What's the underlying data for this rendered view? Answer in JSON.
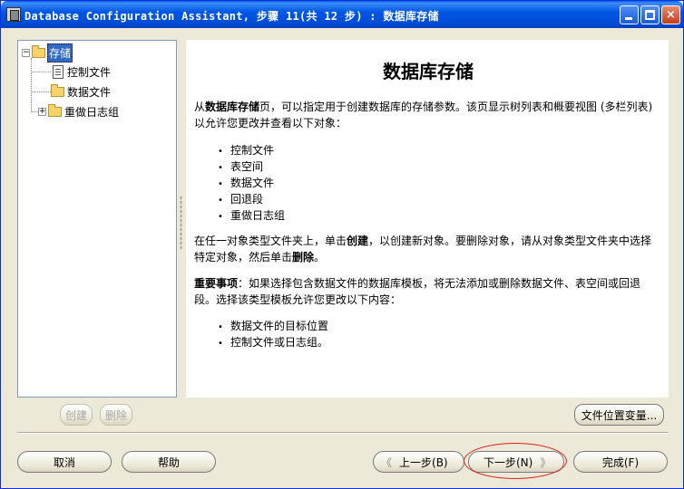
{
  "window": {
    "title": "Database Configuration Assistant, 步骤 11(共 12 步) : 数据库存储",
    "minimize": "minimize",
    "maximize": "maximize",
    "close": "×"
  },
  "tree": {
    "root": "存储",
    "items": [
      "控制文件",
      "数据文件",
      "重做日志组"
    ]
  },
  "content": {
    "title": "数据库存储",
    "intro_pre": "从",
    "intro_bold": "数据库存储",
    "intro_post": "页，可以指定用于创建数据库的存储参数。该页显示树列表和概要视图 (多栏列表) 以允许您更改并查看以下对象：",
    "objects": [
      "控制文件",
      "表空间",
      "数据文件",
      "回退段",
      "重做日志组"
    ],
    "create_pre": "在任一对象类型文件夹上，单击",
    "create_bold": "创建",
    "create_mid": "，以创建新对象。要删除对象，请从对象类型文件夹中选择特定对象，然后单击",
    "create_bold2": "删除",
    "create_end": "。",
    "note_label": "重要事项",
    "note_text": "：如果选择包含数据文件的数据库模板，将无法添加或删除数据文件、表空间或回退段。选择该类型模板允许您更改以下内容：",
    "changeable": [
      "数据文件的目标位置",
      "控制文件或日志组。"
    ]
  },
  "buttons": {
    "create": "创建",
    "delete": "删除",
    "file_location_vars": "文件位置变量...",
    "cancel": "取消",
    "help": "帮助",
    "back": "上一步(B)",
    "next": "下一步(N)",
    "finish": "完成(F)",
    "back_chevron": "《",
    "next_chevron": "》"
  }
}
